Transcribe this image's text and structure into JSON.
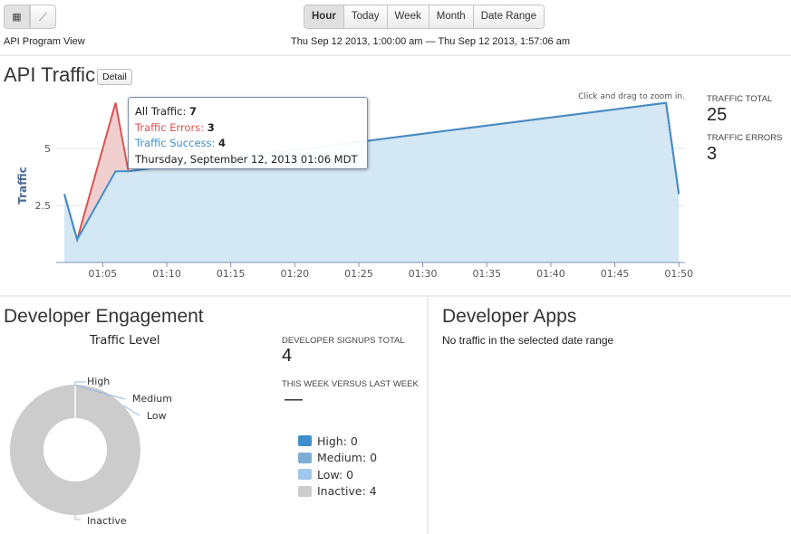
{
  "toolbar": {
    "grid_icon": "grid-icon",
    "chart_icon": "line-chart-icon",
    "view_label": "API Program View",
    "ranges": [
      "Hour",
      "Today",
      "Week",
      "Month",
      "Date Range"
    ],
    "active_range": "Hour",
    "date_range": "Thu Sep 12 2013, 1:00:00 am — Thu Sep 12 2013, 1:57:06 am"
  },
  "traffic": {
    "title": "API Traffic",
    "detail_label": "Detail",
    "zoom_hint": "Click and drag to zoom in.",
    "total_label": "TRAFFIC TOTAL",
    "total_value": "25",
    "errors_label": "TRAFFIC ERRORS",
    "errors_value": "3",
    "tooltip": {
      "all_label": "All Traffic:",
      "all_value": "7",
      "errors_label": "Traffic Errors:",
      "errors_value": "3",
      "success_label": "Traffic Success:",
      "success_value": "4",
      "date": "Thursday, September 12, 2013 01:06 MDT"
    }
  },
  "chart_data": {
    "type": "area",
    "ylabel": "Traffic",
    "yticks": [
      "2.5",
      "5"
    ],
    "ylim": [
      0,
      7.2
    ],
    "xticks": [
      "01:05",
      "01:10",
      "01:15",
      "01:20",
      "01:25",
      "01:30",
      "01:35",
      "01:40",
      "01:45",
      "01:50"
    ],
    "x": [
      "01:02",
      "01:03",
      "01:06",
      "01:07",
      "01:49",
      "01:50"
    ],
    "series": [
      {
        "name": "All Traffic",
        "color": "#d9534f",
        "values": [
          3,
          1,
          7,
          4,
          7,
          3
        ]
      },
      {
        "name": "Traffic Success",
        "color": "#3f8fcb",
        "values": [
          3,
          1,
          4,
          4,
          7,
          3
        ]
      }
    ],
    "grid": true
  },
  "engagement": {
    "title": "Developer Engagement",
    "chart_title": "Traffic Level",
    "pie": [
      {
        "label": "High",
        "value": 0,
        "color": "#3e8fcc"
      },
      {
        "label": "Medium",
        "value": 0,
        "color": "#7eaed8"
      },
      {
        "label": "Low",
        "value": 0,
        "color": "#a0c8ec"
      },
      {
        "label": "Inactive",
        "value": 4,
        "color": "#cccccc"
      }
    ],
    "signups_label": "DEVELOPER SIGNUPS TOTAL",
    "signups_value": "4",
    "week_label": "THIS WEEK VERSUS LAST WEEK",
    "week_value": "—",
    "legend": [
      "High: 0",
      "Medium: 0",
      "Low: 0",
      "Inactive: 4"
    ]
  },
  "apps": {
    "title": "Developer Apps",
    "empty": "No traffic in the selected date range"
  }
}
